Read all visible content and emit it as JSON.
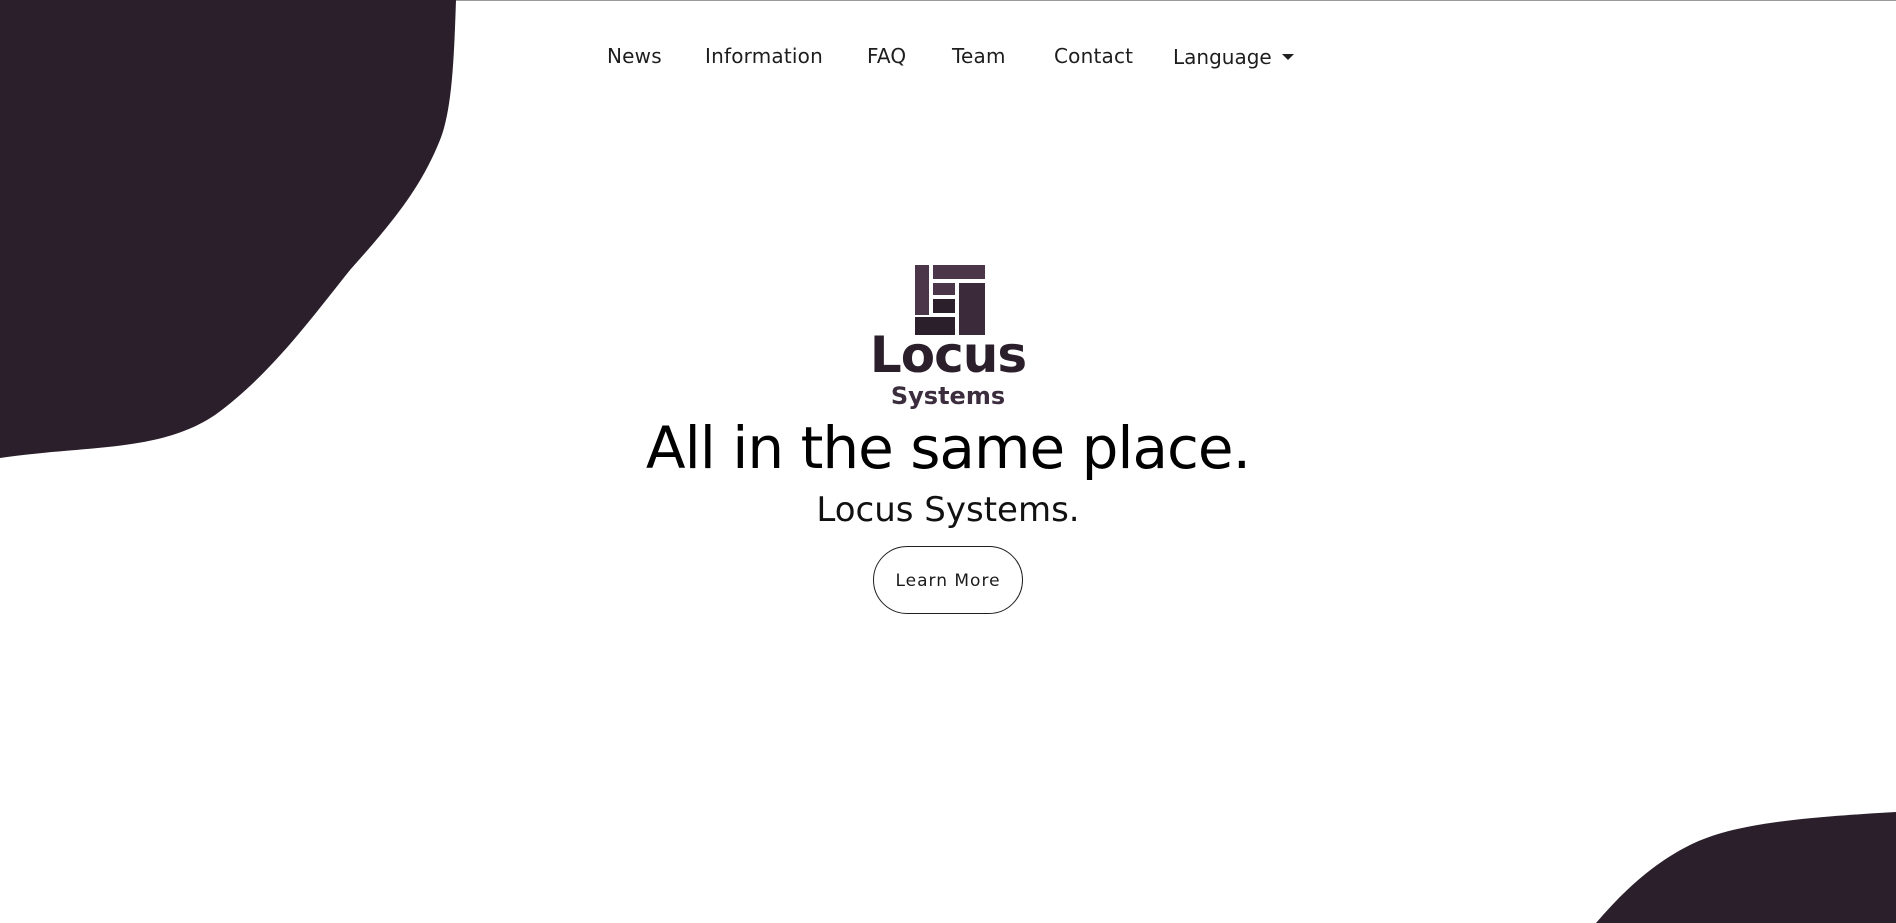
{
  "nav": {
    "items": [
      {
        "label": "News"
      },
      {
        "label": "Information"
      },
      {
        "label": "FAQ"
      },
      {
        "label": "Team"
      },
      {
        "label": "Contact"
      }
    ],
    "language_label": "Language"
  },
  "logo": {
    "wordmark": "Locus",
    "subtitle": "Systems"
  },
  "hero": {
    "headline": "All in the same place.",
    "subheadline": "Locus Systems.",
    "cta_label": "Learn More"
  },
  "colors": {
    "accent": "#2a1f2b",
    "background": "#ffffff",
    "text": "#000000"
  },
  "icons": [
    "caret-down-icon",
    "locus-logo-mark-icon"
  ]
}
